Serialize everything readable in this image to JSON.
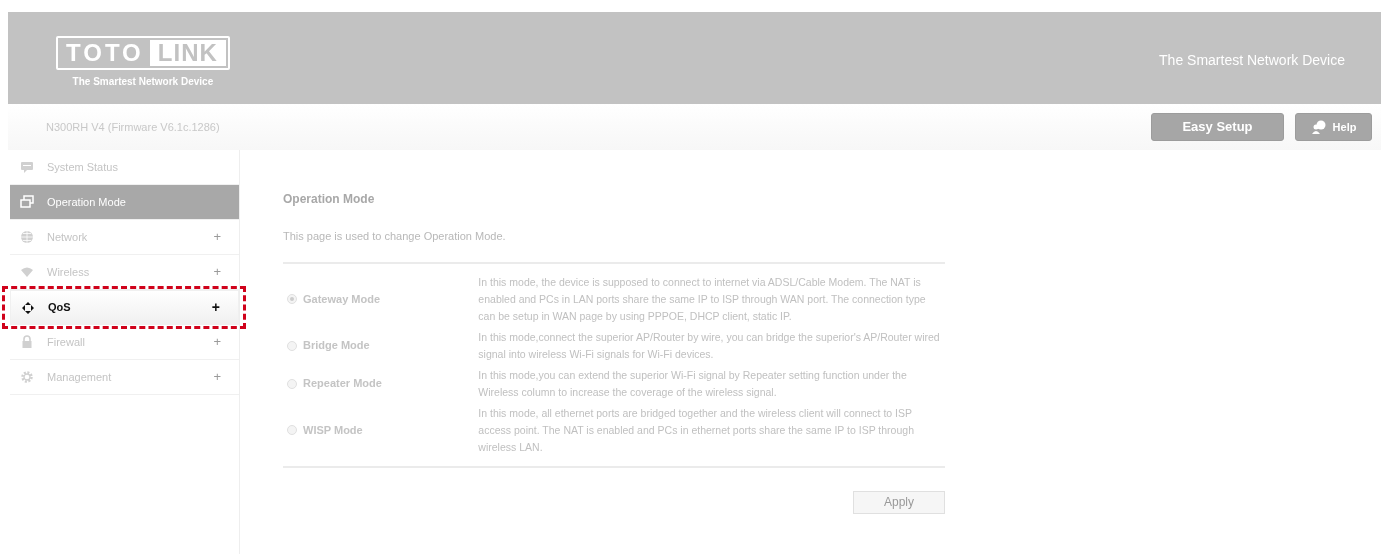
{
  "header": {
    "logo": {
      "left": "TOTO",
      "right": "LINK",
      "tagline": "The Smartest Network Device"
    },
    "slogan": "The Smartest Network Device"
  },
  "subheader": {
    "device": "N300RH V4 (Firmware V6.1c.1286)",
    "buttons": [
      {
        "label": "Easy Setup",
        "kind": "text"
      },
      {
        "label": "Help",
        "kind": "help"
      }
    ]
  },
  "sidebar": {
    "items": [
      {
        "label": "System Status",
        "kind": "chat",
        "selected": false,
        "highlighted": false
      },
      {
        "label": "Operation Mode",
        "kind": "windows",
        "selected": true,
        "highlighted": false
      },
      {
        "label": "Network",
        "kind": "globe",
        "toggle": "+",
        "selected": false,
        "highlighted": false
      },
      {
        "label": "Wireless",
        "kind": "wifi",
        "toggle": "+",
        "selected": false,
        "highlighted": false
      },
      {
        "label": "QoS",
        "kind": "arrows",
        "toggle": "+",
        "selected": false,
        "highlighted": true
      },
      {
        "label": "Firewall",
        "kind": "lock",
        "toggle": "+",
        "selected": false,
        "highlighted": false
      },
      {
        "label": "Management",
        "kind": "gear",
        "toggle": "+",
        "selected": false,
        "highlighted": false
      }
    ]
  },
  "main": {
    "title": "Operation Mode",
    "description": "This page is used to change Operation Mode.",
    "modes": [
      {
        "label": "Gateway Mode",
        "selected": true,
        "description": "In this mode, the device is supposed to connect to internet via ADSL/Cable Modem. The NAT is enabled and PCs in LAN ports share the same IP to ISP through WAN port. The connection type can be setup in WAN page by using PPPOE, DHCP client, static IP."
      },
      {
        "label": "Bridge Mode",
        "selected": false,
        "description": "In this mode,connect the superior AP/Router by wire, you can bridge the superior's AP/Router wired signal into wireless Wi-Fi signals for Wi-Fi devices."
      },
      {
        "label": "Repeater Mode",
        "selected": false,
        "description": "In this mode,you can extend the superior Wi-Fi signal by Repeater setting function under the Wireless column to increase the coverage of the wireless signal."
      },
      {
        "label": "WISP Mode",
        "selected": false,
        "description": "In this mode, all ethernet ports are bridged together and the wireless client will connect to ISP access point. The NAT is enabled and PCs in ethernet ports share the same IP to ISP through wireless LAN."
      }
    ],
    "apply_button": "Apply"
  }
}
